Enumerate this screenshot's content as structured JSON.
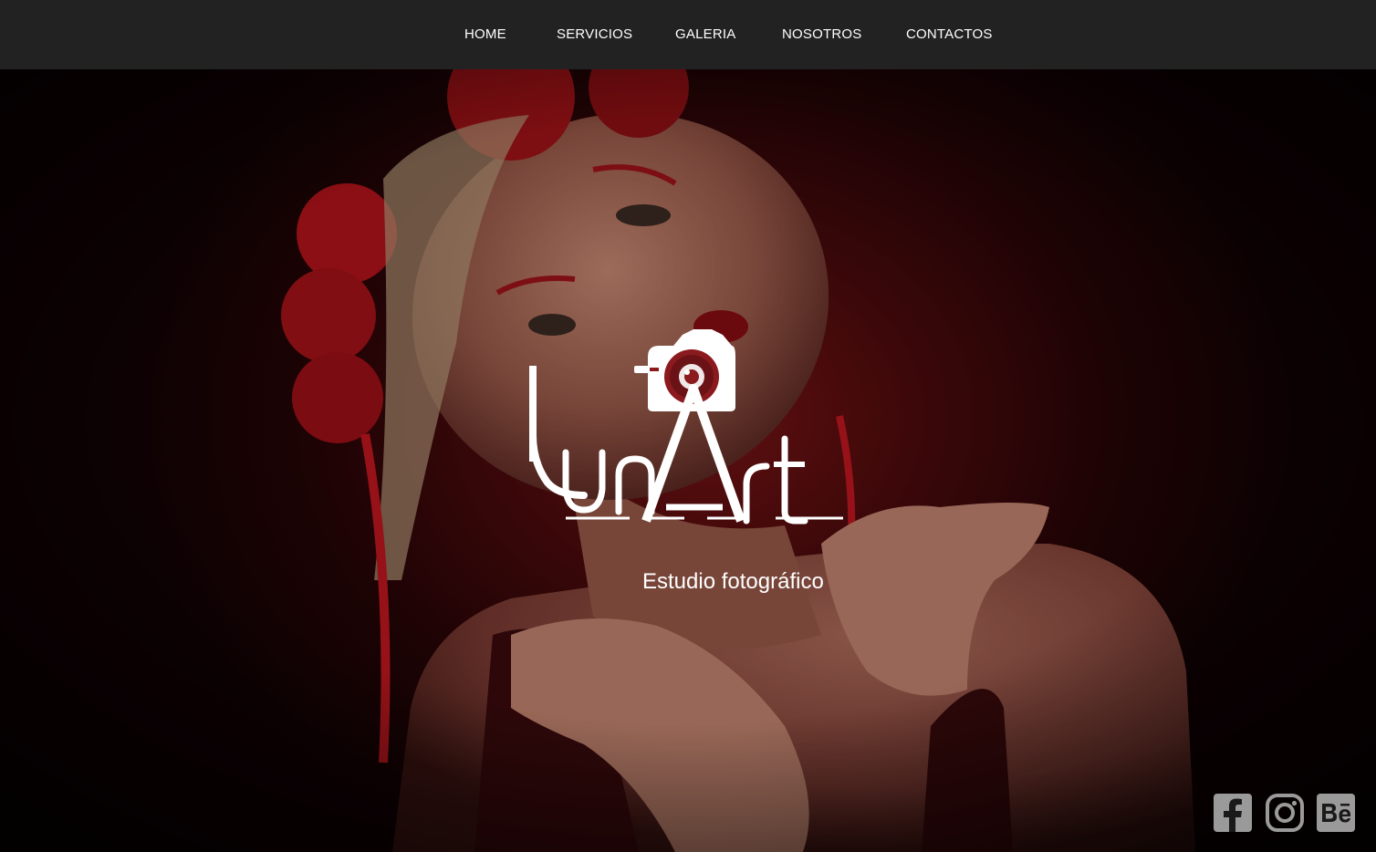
{
  "nav": {
    "items": [
      {
        "label": "HOME"
      },
      {
        "label": "SERVICIOS"
      },
      {
        "label": "GALERIA"
      },
      {
        "label": "NOSOTROS"
      },
      {
        "label": "CONTACTOS"
      }
    ]
  },
  "hero": {
    "logo_text": "LunArt",
    "tagline": "Estudio fotográfico"
  },
  "social": {
    "items": [
      {
        "icon": "facebook-icon"
      },
      {
        "icon": "instagram-icon"
      },
      {
        "icon": "behance-icon"
      }
    ]
  },
  "colors": {
    "nav_bg": "#222222",
    "accent": "#8b1a1e",
    "icon_gray": "#9a9a9a"
  }
}
